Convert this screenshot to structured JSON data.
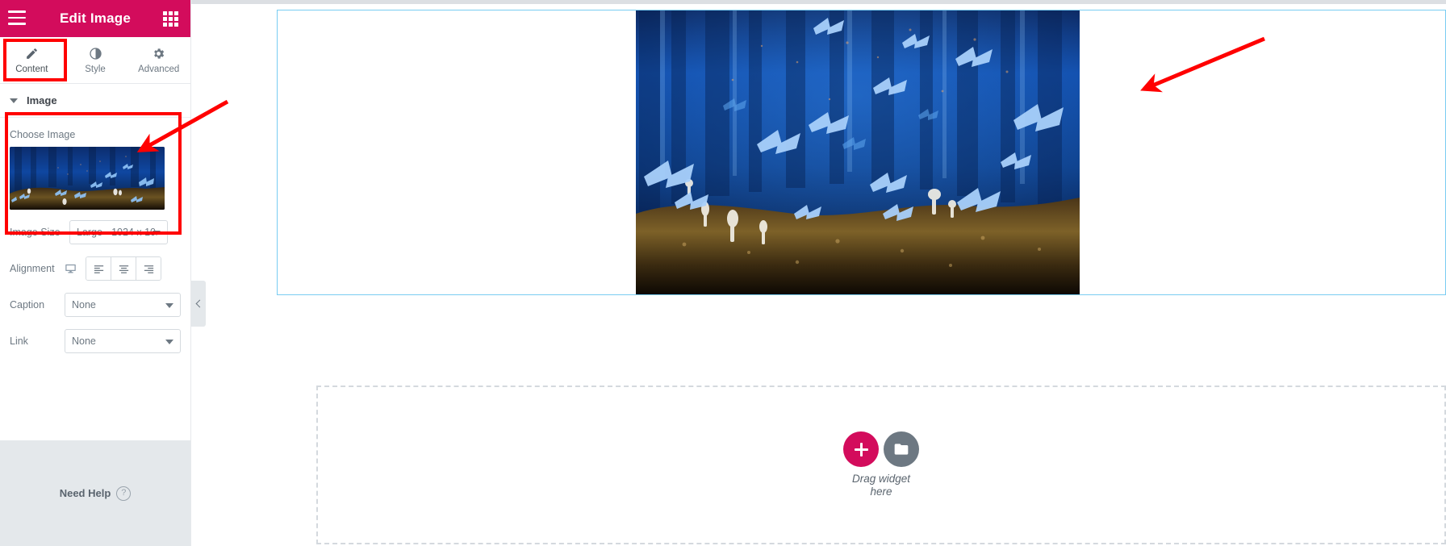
{
  "panel": {
    "header": {
      "title": "Edit Image",
      "menu_icon": "hamburger-icon",
      "grid_icon": "apps-grid-icon"
    },
    "tabs": [
      {
        "label": "Content",
        "icon": "pencil-icon",
        "active": true
      },
      {
        "label": "Style",
        "icon": "contrast-half-circle-icon",
        "active": false
      },
      {
        "label": "Advanced",
        "icon": "gear-icon",
        "active": false
      }
    ],
    "section": {
      "title": "Image",
      "collapse_icon": "caret-down-icon"
    },
    "fields": {
      "choose_image_label": "Choose Image",
      "image_thumbnail_alt": "blue butterflies in dark forest",
      "image_size_label": "Image Size",
      "image_size_value": "Large - 1024 x 10",
      "alignment_label": "Alignment",
      "alignment_device_icon": "desktop-monitor-icon",
      "alignment_options": [
        "align-left-icon",
        "align-center-icon",
        "align-right-icon"
      ],
      "caption_label": "Caption",
      "caption_value": "None",
      "link_label": "Link",
      "link_value": "None"
    },
    "footer": {
      "need_help_label": "Need Help",
      "help_icon": "question-circle-icon"
    }
  },
  "canvas": {
    "collapse_icon": "chevron-left-icon",
    "dropzone": {
      "add_icon": "plus-icon",
      "folder_icon": "folder-icon",
      "text": "Drag widget here"
    }
  },
  "colors": {
    "brand_pink": "#d30c5c",
    "selection_blue": "#79ccf2",
    "annotation_red": "#ff0000",
    "panel_footer_gray": "#e4e8eb",
    "muted_text": "#6d7882"
  }
}
